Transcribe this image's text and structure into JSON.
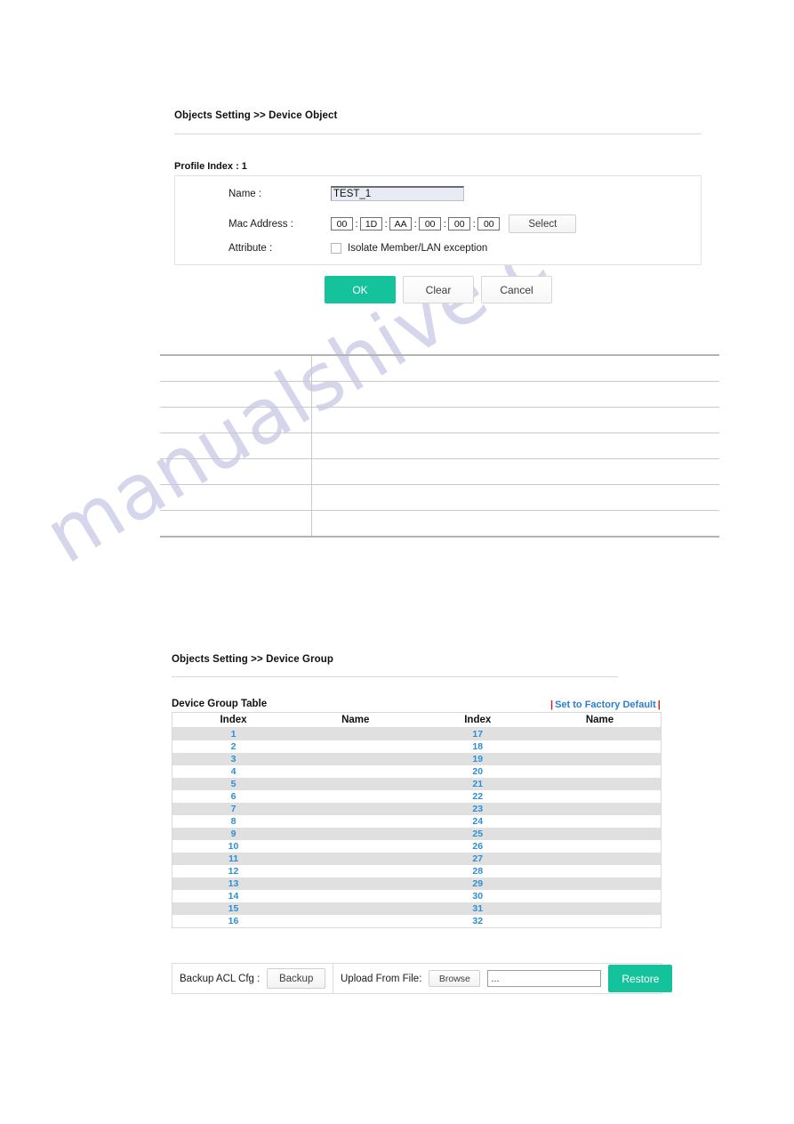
{
  "watermark": {
    "text": "manualshive.com"
  },
  "device_object": {
    "breadcrumb": "Objects Setting >> Device Object",
    "profile_index_label": "Profile Index : 1",
    "fields": {
      "name_label": "Name :",
      "name_value": "TEST_1",
      "mac_label": "Mac Address :",
      "mac_octets": [
        "00",
        "1D",
        "AA",
        "00",
        "00",
        "00"
      ],
      "mac_separator": ":",
      "select_button": "Select",
      "attribute_label": "Attribute :",
      "isolate_checkbox_label": "Isolate Member/LAN exception",
      "isolate_checked": false
    },
    "actions": {
      "ok": "OK",
      "clear": "Clear",
      "cancel": "Cancel"
    }
  },
  "blank_table": {
    "rows": 7,
    "columns": 2,
    "cells": [
      [
        "",
        ""
      ],
      [
        "",
        ""
      ],
      [
        "",
        ""
      ],
      [
        "",
        ""
      ],
      [
        "",
        ""
      ],
      [
        "",
        ""
      ],
      [
        "",
        ""
      ]
    ]
  },
  "device_group": {
    "breadcrumb": "Objects Setting >> Device Group",
    "table_caption": "Device Group Table",
    "factory_default_link": "Set to Factory Default",
    "pipe": "|",
    "headers": [
      "Index",
      "Name",
      "Index",
      "Name"
    ],
    "rows": [
      {
        "index_left": "1",
        "name_left": "",
        "index_right": "17",
        "name_right": ""
      },
      {
        "index_left": "2",
        "name_left": "",
        "index_right": "18",
        "name_right": ""
      },
      {
        "index_left": "3",
        "name_left": "",
        "index_right": "19",
        "name_right": ""
      },
      {
        "index_left": "4",
        "name_left": "",
        "index_right": "20",
        "name_right": ""
      },
      {
        "index_left": "5",
        "name_left": "",
        "index_right": "21",
        "name_right": ""
      },
      {
        "index_left": "6",
        "name_left": "",
        "index_right": "22",
        "name_right": ""
      },
      {
        "index_left": "7",
        "name_left": "",
        "index_right": "23",
        "name_right": ""
      },
      {
        "index_left": "8",
        "name_left": "",
        "index_right": "24",
        "name_right": ""
      },
      {
        "index_left": "9",
        "name_left": "",
        "index_right": "25",
        "name_right": ""
      },
      {
        "index_left": "10",
        "name_left": "",
        "index_right": "26",
        "name_right": ""
      },
      {
        "index_left": "11",
        "name_left": "",
        "index_right": "27",
        "name_right": ""
      },
      {
        "index_left": "12",
        "name_left": "",
        "index_right": "28",
        "name_right": ""
      },
      {
        "index_left": "13",
        "name_left": "",
        "index_right": "29",
        "name_right": ""
      },
      {
        "index_left": "14",
        "name_left": "",
        "index_right": "30",
        "name_right": ""
      },
      {
        "index_left": "15",
        "name_left": "",
        "index_right": "31",
        "name_right": ""
      },
      {
        "index_left": "16",
        "name_left": "",
        "index_right": "32",
        "name_right": ""
      }
    ]
  },
  "backup_bar": {
    "backup_label": "Backup ACL Cfg :",
    "backup_button": "Backup",
    "upload_label": "Upload From File:",
    "browse_button": "Browse",
    "file_value": "...",
    "restore_button": "Restore"
  },
  "colors": {
    "accent_green": "#14c39c",
    "link_blue": "#2b8fd4",
    "pipe_red": "#cf2020",
    "row_alt": "#e0e0e0",
    "watermark": "#d3d3ec"
  }
}
